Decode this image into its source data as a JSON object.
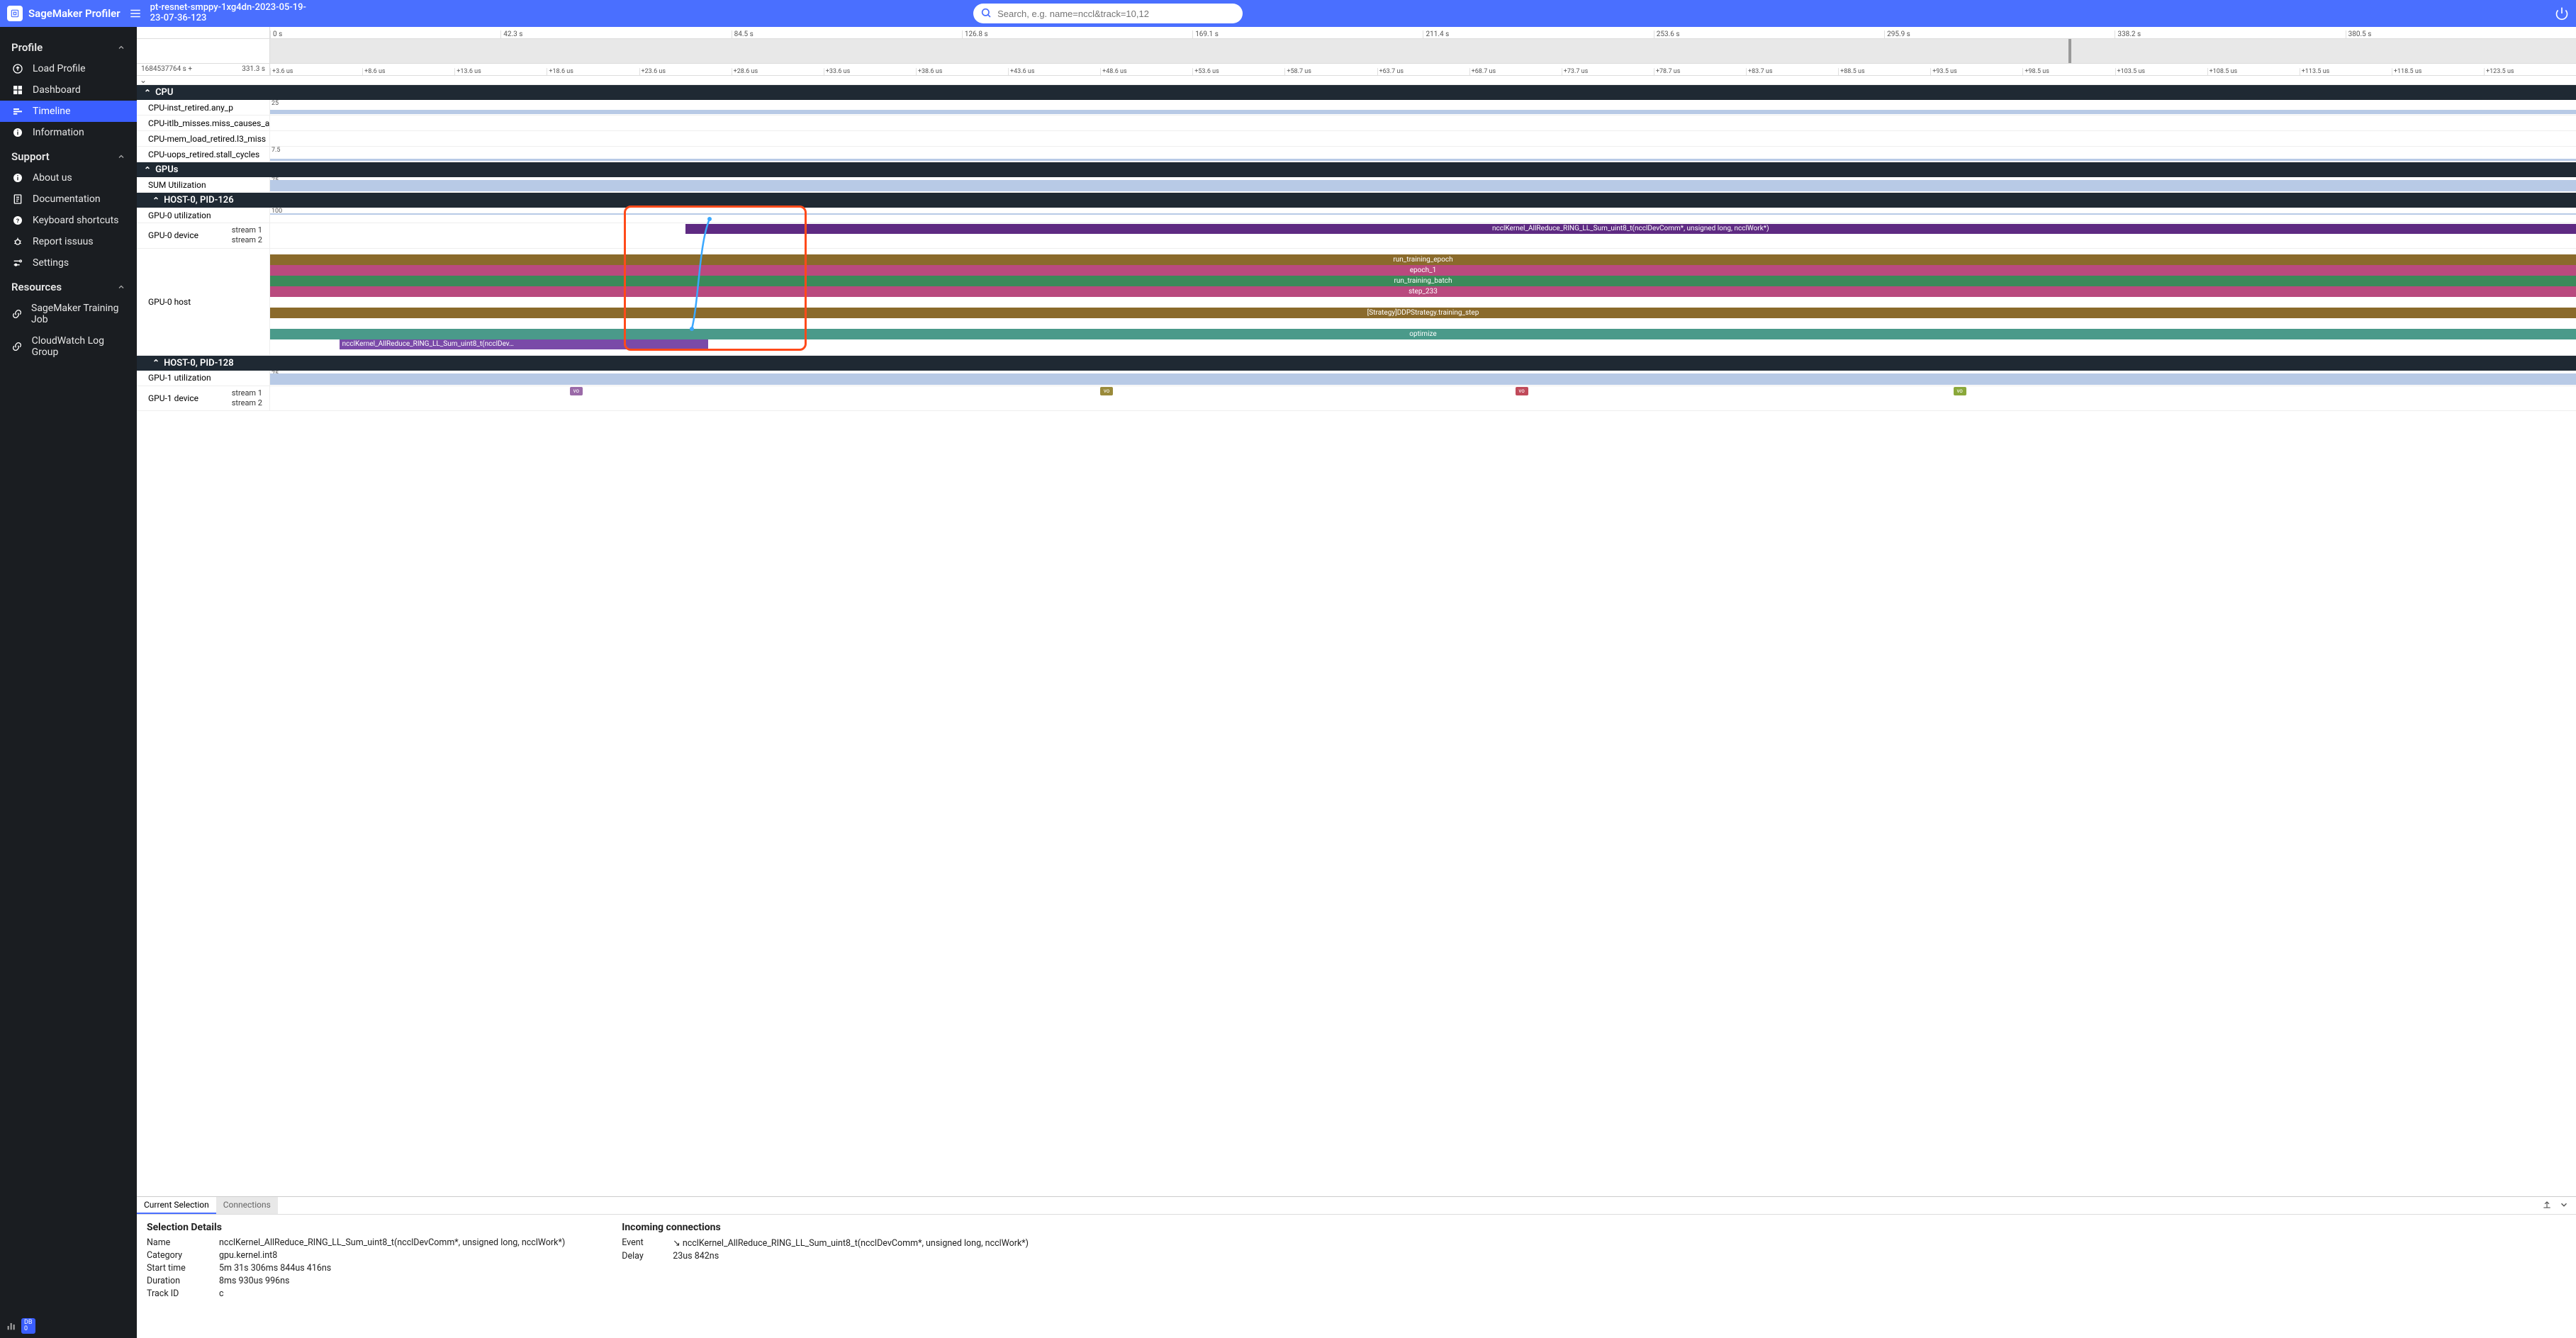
{
  "app": {
    "name": "SageMaker Profiler",
    "title": "pt-resnet-smppy-1xg4dn-2023-05-19-23-07-36-123",
    "search_placeholder": "Search, e.g. name=nccl&track=10,12"
  },
  "sidebar": {
    "groups": [
      {
        "title": "Profile",
        "items": [
          {
            "icon": "upload",
            "label": "Load Profile"
          },
          {
            "icon": "dashboard",
            "label": "Dashboard"
          },
          {
            "icon": "timeline",
            "label": "Timeline",
            "active": true
          },
          {
            "icon": "info",
            "label": "Information"
          }
        ]
      },
      {
        "title": "Support",
        "items": [
          {
            "icon": "info",
            "label": "About us"
          },
          {
            "icon": "doc",
            "label": "Documentation"
          },
          {
            "icon": "help",
            "label": "Keyboard shortcuts"
          },
          {
            "icon": "bug",
            "label": "Report issuus"
          },
          {
            "icon": "settings",
            "label": "Settings"
          }
        ]
      },
      {
        "title": "Resources",
        "items": [
          {
            "icon": "link",
            "label": "SageMaker Training Job"
          },
          {
            "icon": "link",
            "label": "CloudWatch Log Group"
          }
        ]
      }
    ],
    "footer_badge_top": "DB",
    "footer_badge_bottom": "0"
  },
  "top_ruler": [
    "0 s",
    "42.3 s",
    "84.5 s",
    "126.8 s",
    "169.1 s",
    "211.4 s",
    "253.6 s",
    "295.9 s",
    "338.2 s",
    "380.5 s"
  ],
  "sub_ruler_left": "1684537764 s +",
  "sub_ruler_right": "331.3 s",
  "sub_ruler": [
    "+3.6 us",
    "+8.6 us",
    "+13.6 us",
    "+18.6 us",
    "+23.6 us",
    "+28.6 us",
    "+33.6 us",
    "+38.6 us",
    "+43.6 us",
    "+48.6 us",
    "+53.6 us",
    "+58.7 us",
    "+63.7 us",
    "+68.7 us",
    "+73.7 us",
    "+78.7 us",
    "+83.7 us",
    "+88.5 us",
    "+93.5 us",
    "+98.5 us",
    "+103.5 us",
    "+108.5 us",
    "+113.5 us",
    "+118.5 us",
    "+123.5 us"
  ],
  "sections": {
    "cpu": {
      "title": "CPU",
      "rows": [
        {
          "label": "CPU-inst_retired.any_p",
          "y": "25"
        },
        {
          "label": "CPU-itlb_misses.miss_causes_a_walk"
        },
        {
          "label": "CPU-mem_load_retired.l3_miss"
        },
        {
          "label": "CPU-uops_retired.stall_cycles",
          "y": "7.5"
        }
      ]
    },
    "gpus": {
      "title": "GPUs",
      "rows": [
        {
          "label": "SUM Utilization",
          "y": "75"
        }
      ]
    },
    "h0p126": {
      "title": "HOST-0, PID-126",
      "gpu_util_label": "GPU-0 utilization",
      "gpu_util_y": "100",
      "gpu_device_label": "GPU-0 device",
      "stream1": "stream 1",
      "stream2": "stream 2",
      "nccl_device": "ncclKernel_AllReduce_RING_LL_Sum_uint8_t(ncclDevComm*, unsigned long, ncclWork*)",
      "gpu_host_label": "GPU-0 host",
      "host_rows": [
        {
          "color": "brown",
          "text": "run_training_epoch"
        },
        {
          "color": "pink",
          "text": "epoch_1"
        },
        {
          "color": "green",
          "text": "run_training_batch"
        },
        {
          "color": "pink",
          "text": "step_233"
        },
        {
          "color": "blank",
          "text": ""
        },
        {
          "color": "brown",
          "text": "[Strategy]DDPStrategy.training_step"
        },
        {
          "color": "blank",
          "text": ""
        },
        {
          "color": "teal",
          "text": "optimize"
        }
      ],
      "nccl_host": "ncclKernel_AllReduce_RING_LL_Sum_uint8_t(ncclDev…"
    },
    "h0p128": {
      "title": "HOST-0, PID-128",
      "gpu_util_label": "GPU-1 utilization",
      "gpu_util_y": "75",
      "gpu_device_label": "GPU-1 device",
      "stream1": "stream 1",
      "stream2": "stream 2",
      "tiny": "vo"
    }
  },
  "details": {
    "tabs": {
      "selection": "Current Selection",
      "connections": "Connections"
    },
    "selection_title": "Selection Details",
    "name_k": "Name",
    "name_v": "ncclKernel_AllReduce_RING_LL_Sum_uint8_t(ncclDevComm*, unsigned long, ncclWork*)",
    "cat_k": "Category",
    "cat_v": "gpu.kernel.int8",
    "start_k": "Start time",
    "start_v": "5m 31s 306ms 844us 416ns",
    "dur_k": "Duration",
    "dur_v": "8ms 930us 996ns",
    "track_k": "Track ID",
    "track_v": "c",
    "incoming_title": "Incoming connections",
    "event_k": "Event",
    "event_v": "ncclKernel_AllReduce_RING_LL_Sum_uint8_t(ncclDevComm*, unsigned long, ncclWork*)",
    "delay_k": "Delay",
    "delay_v": "23us 842ns"
  }
}
